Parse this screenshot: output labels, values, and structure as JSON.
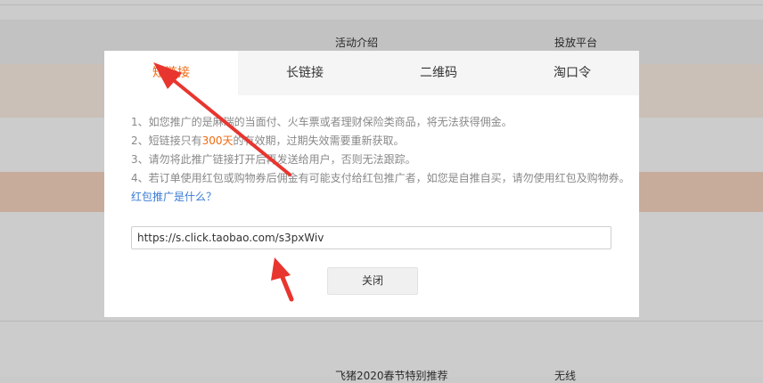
{
  "background": {
    "header_items": [
      "活动介绍",
      "投放平台"
    ],
    "footer_items": [
      "飞猪2020春节特别推荐",
      "无线"
    ]
  },
  "modal": {
    "tabs": [
      {
        "label": "短链接",
        "active": true
      },
      {
        "label": "长链接",
        "active": false
      },
      {
        "label": "二维码",
        "active": false
      },
      {
        "label": "淘口令",
        "active": false
      }
    ],
    "notes": {
      "line1": "1、如您推广的是麻瑞的当面付、火车票或者理财保险类商品，将无法获得佣金。",
      "line2_prefix": "2、短链接只有",
      "line2_highlight": "300天",
      "line2_suffix": "的有效期，过期失效需要重新获取。",
      "line3": "3、请勿将此推广链接打开后再发送给用户，否则无法跟踪。",
      "line4": "4、若订单使用红包或购物券后佣金有可能支付给红包推广者，如您是自推自买，请勿使用红包及购物券。",
      "line4_link": "红包推广是什么？"
    },
    "url_value": "https://s.click.taobao.com/s3pxWiv",
    "close_label": "关闭"
  },
  "colors": {
    "accent": "#f06a0f",
    "link": "#3a7bd5",
    "annotation_arrow": "#e8352f"
  }
}
